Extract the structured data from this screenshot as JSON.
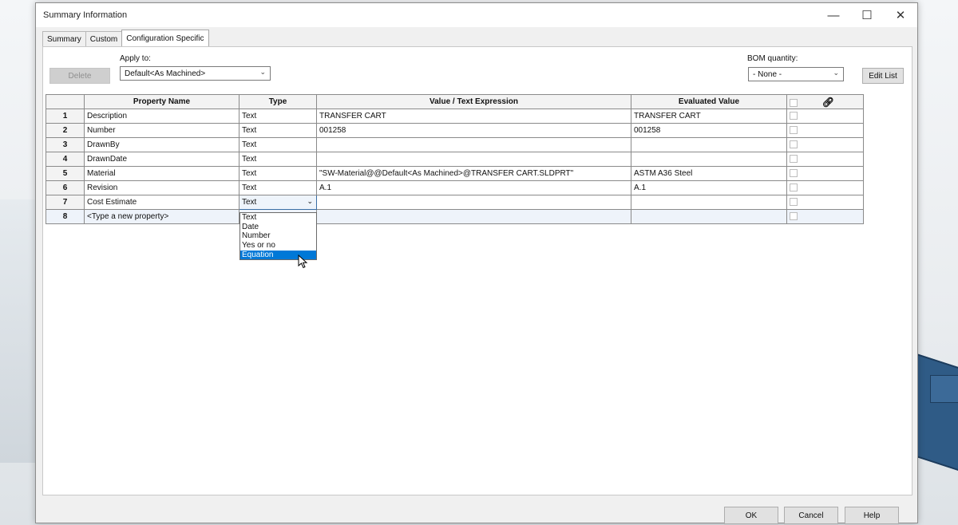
{
  "window": {
    "title": "Summary Information",
    "minimize_icon": "minimize-icon",
    "maximize_icon": "maximize-icon",
    "close_icon": "close-icon"
  },
  "tabs": [
    {
      "label": "Summary",
      "active": false
    },
    {
      "label": "Custom",
      "active": false
    },
    {
      "label": "Configuration Specific",
      "active": true
    }
  ],
  "toolbar": {
    "delete_label": "Delete",
    "apply_to_label": "Apply to:",
    "apply_to_value": "Default<As Machined>",
    "bom_label": "BOM quantity:",
    "bom_value": "- None -",
    "edit_list_label": "Edit List"
  },
  "table": {
    "headers": [
      "Property Name",
      "Type",
      "Value / Text Expression",
      "Evaluated Value"
    ],
    "link_icon": "link-icon",
    "rows": [
      {
        "num": "1",
        "name": "Description",
        "type": "Text",
        "value": "TRANSFER CART",
        "evaluated": "TRANSFER CART"
      },
      {
        "num": "2",
        "name": "Number",
        "type": "Text",
        "value": "001258",
        "evaluated": "001258"
      },
      {
        "num": "3",
        "name": "DrawnBy",
        "type": "Text",
        "value": "",
        "evaluated": ""
      },
      {
        "num": "4",
        "name": "DrawnDate",
        "type": "Text",
        "value": "",
        "evaluated": ""
      },
      {
        "num": "5",
        "name": "Material",
        "type": "Text",
        "value": "\"SW-Material@@Default<As Machined>@TRANSFER CART.SLDPRT\"",
        "evaluated": "ASTM A36 Steel"
      },
      {
        "num": "6",
        "name": "Revision",
        "type": "Text",
        "value": "A.1",
        "evaluated": "A.1"
      },
      {
        "num": "7",
        "name": "Cost Estimate",
        "type": "Text",
        "value": "",
        "evaluated": ""
      },
      {
        "num": "8",
        "name": "<Type a new property>",
        "type": "",
        "value": "",
        "evaluated": ""
      }
    ]
  },
  "type_dropdown": {
    "options": [
      "Text",
      "Date",
      "Number",
      "Yes or no",
      "Equation"
    ],
    "highlighted": "Equation"
  },
  "footer": {
    "ok_label": "OK",
    "cancel_label": "Cancel",
    "help_label": "Help"
  }
}
